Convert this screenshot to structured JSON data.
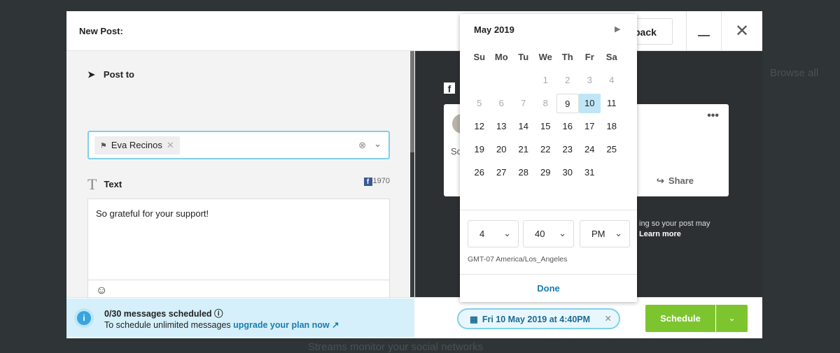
{
  "background": {
    "browse": "Browse all",
    "streams": "Streams monitor your social networks"
  },
  "header": {
    "title": "New Post:",
    "back_label": "back",
    "close": "✕"
  },
  "composer": {
    "post_to_label": "Post to",
    "selected_profile": "Eva Recinos",
    "text_label": "Text",
    "char_count": "1970",
    "text_value": "So grateful for your support!",
    "emoji": "☺"
  },
  "banner": {
    "count": "0/30 messages scheduled",
    "prefix": "To schedule unlimited messages ",
    "link": "upgrade your plan now"
  },
  "preview": {
    "snippet": "So",
    "more": "•••",
    "share": "Share",
    "note": "ing so your post may",
    "learn_more": "Learn more"
  },
  "calendar": {
    "month": "May 2019",
    "weekdays": [
      "Su",
      "Mo",
      "Tu",
      "We",
      "Th",
      "Fr",
      "Sa"
    ],
    "weeks": [
      [
        "",
        "",
        "",
        "1",
        "2",
        "3",
        "4"
      ],
      [
        "5",
        "6",
        "7",
        "8",
        "9",
        "10",
        "11"
      ],
      [
        "12",
        "13",
        "14",
        "15",
        "16",
        "17",
        "18"
      ],
      [
        "19",
        "20",
        "21",
        "22",
        "23",
        "24",
        "25"
      ],
      [
        "26",
        "27",
        "28",
        "29",
        "30",
        "31",
        ""
      ]
    ],
    "disabled": [
      "1",
      "2",
      "3",
      "4",
      "5",
      "6",
      "7",
      "8"
    ],
    "today": "9",
    "selected": "10",
    "hour": "4",
    "minute": "40",
    "ampm": "PM",
    "timezone": "GMT-07 America/Los_Angeles",
    "done": "Done"
  },
  "footer": {
    "date": "Fri 10 May 2019 at 4:40PM",
    "schedule": "Schedule"
  },
  "colors": {
    "accent": "#7dc52e",
    "link": "#1a7bb0",
    "selected_day": "#bfe6f7"
  }
}
